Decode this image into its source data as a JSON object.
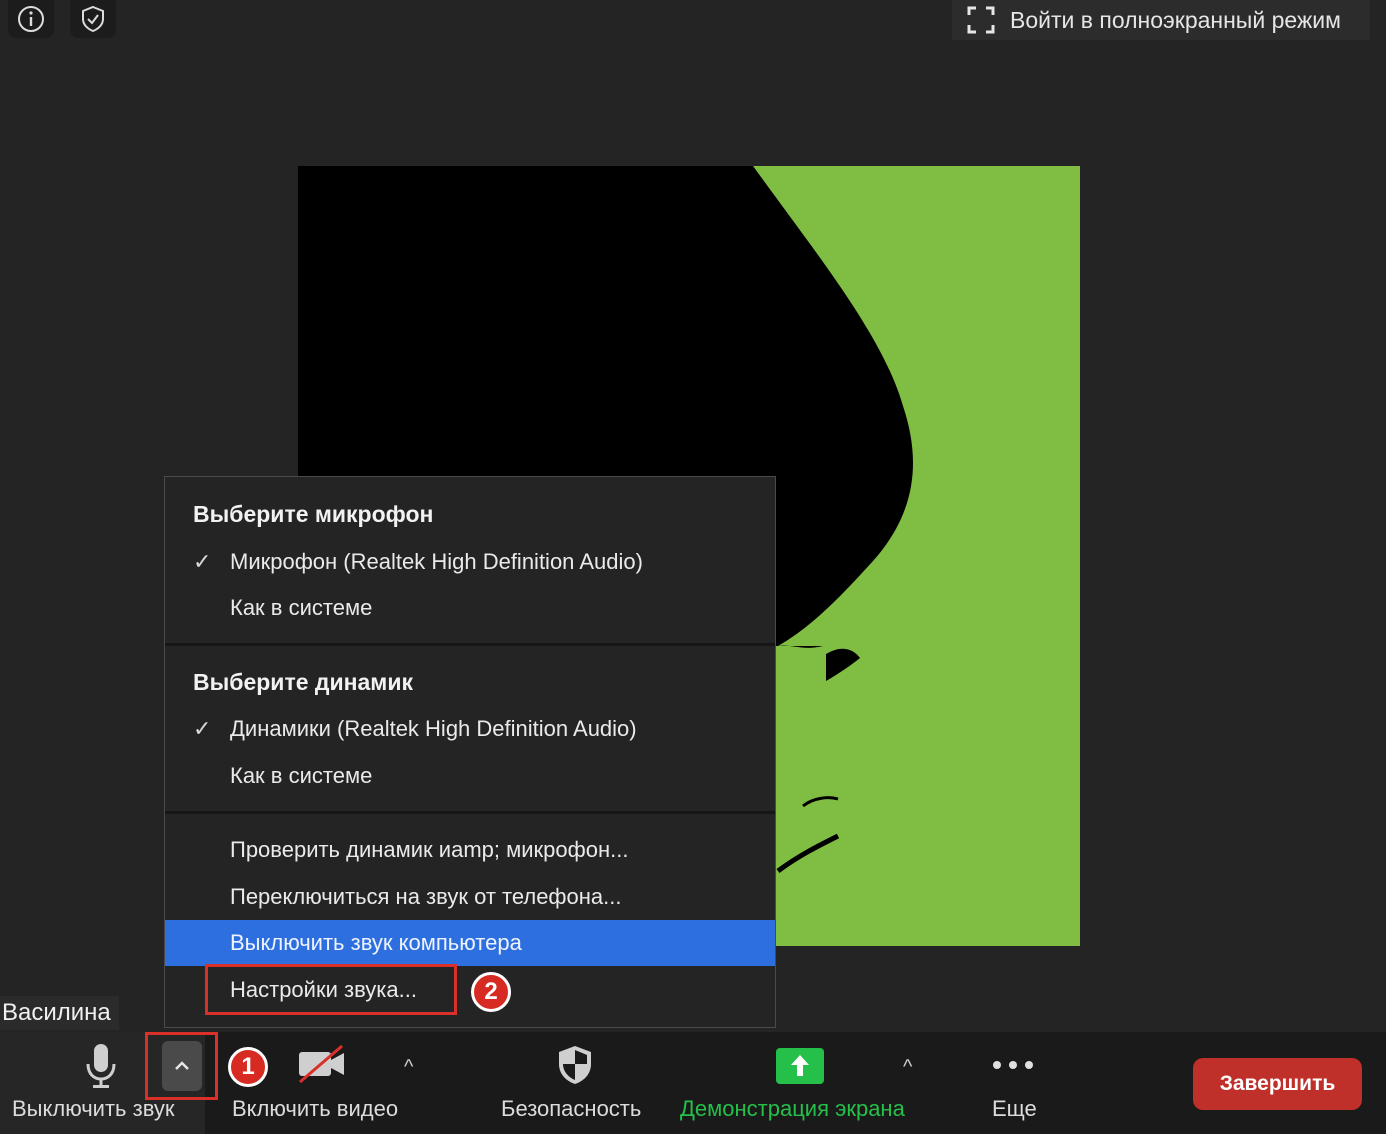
{
  "top_bar": {
    "info_icon": "info-icon",
    "security_icon": "shield-check-icon",
    "fullscreen_label": "Войти в полноэкранный режим"
  },
  "participant": {
    "name": "Василина"
  },
  "audio_menu": {
    "mic_heading": "Выберите микрофон",
    "mic_options": [
      {
        "label": "Микрофон (Realtek High Definition Audio)",
        "checked": true
      },
      {
        "label": "Как в системе",
        "checked": false
      }
    ],
    "speaker_heading": "Выберите динамик",
    "speaker_options": [
      {
        "label": "Динамики (Realtek High Definition Audio)",
        "checked": true
      },
      {
        "label": "Как в системе",
        "checked": false
      }
    ],
    "actions": [
      "Проверить динамик иamp; микрофон...",
      "Переключиться на звук от телефона...",
      "Выключить звук компьютера",
      "Настройки звука..."
    ],
    "check_mark": "✓"
  },
  "annotations": {
    "badge_1": "1",
    "badge_2": "2"
  },
  "toolbar": {
    "mute_label": "Выключить звук",
    "video_label": "Включить видео",
    "security_label": "Безопасность",
    "share_label": "Демонстрация экрана",
    "more_label": "Еще",
    "end_label": "Завершить",
    "caret": "^"
  },
  "colors": {
    "background": "#242424",
    "video_green": "#7fbd43",
    "menu_highlight": "#2e6fe0",
    "share_green": "#25c04a",
    "end_red": "#c0302a",
    "annotation_red": "#d62a22"
  }
}
